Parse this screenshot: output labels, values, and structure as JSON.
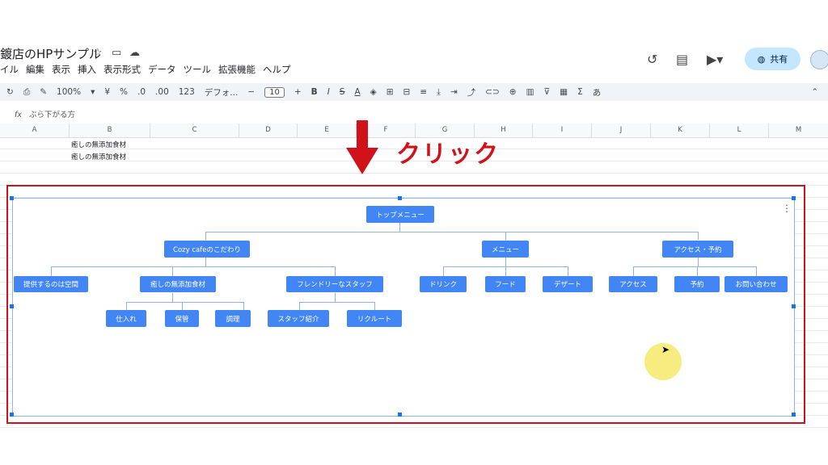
{
  "app": {
    "doc_title": "鍍店のHPサンプル",
    "menu": [
      "イル",
      "編集",
      "表示",
      "挿入",
      "表示形式",
      "データ",
      "ツール",
      "拡張機能",
      "ヘルプ"
    ],
    "share_label": "共有"
  },
  "toolbar": {
    "zoom": "100%",
    "currency": "¥",
    "percent": "%",
    "dec_decrease": ".0",
    "dec_increase": ".00",
    "number_format": "123",
    "font": "デフォ...",
    "font_size": "10",
    "bold": "B",
    "italic": "I",
    "strike": "S",
    "text_color": "A",
    "sum": "Σ",
    "input_mode": "あ"
  },
  "formula_bar": {
    "fx": "fx",
    "value": "ぶら下がる方"
  },
  "sheet": {
    "columns": [
      "A",
      "B",
      "C",
      "D",
      "E",
      "F",
      "G",
      "H",
      "I",
      "J",
      "K",
      "L",
      "M"
    ],
    "b1": "癒しの無添加食材",
    "b2": "癒しの無添加食材"
  },
  "annotation": {
    "click_label": "クリック"
  },
  "org_chart": {
    "root": "トップメニュー",
    "level1": [
      "Cozy cafeのこだわり",
      "メニュー",
      "アクセス・予約"
    ],
    "cozy_children": [
      "提供するのは空間",
      "癒しの無添加食材",
      "フレンドリーなスタッフ"
    ],
    "menu_children": [
      "ドリンク",
      "フード",
      "デザート"
    ],
    "access_children": [
      "アクセス",
      "予約",
      "お問い合わせ"
    ],
    "food_children": [
      "仕入れ",
      "保管",
      "調理"
    ],
    "staff_children": [
      "スタッフ紹介",
      "リクルート"
    ]
  },
  "colors": {
    "accent": "#d0121b",
    "node": "#4285f4",
    "share": "#c2e7ff"
  }
}
